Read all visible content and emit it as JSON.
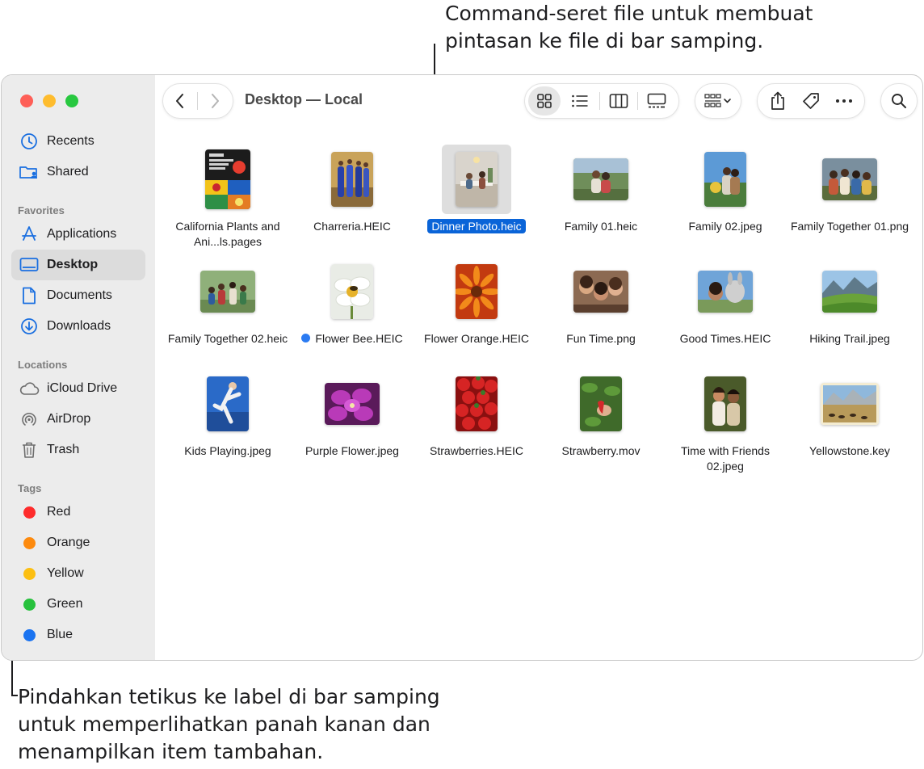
{
  "callouts": {
    "top_line1": "Command-seret file untuk membuat",
    "top_line2": "pintasan ke file di bar samping.",
    "bottom_line1": "Pindahkan tetikus ke label di bar samping",
    "bottom_line2": "untuk memperlihatkan panah kanan dan",
    "bottom_line3": "menampilkan item tambahan."
  },
  "window": {
    "traffic_lights": {
      "close": "#fe5f57",
      "minimize": "#febc2e",
      "zoom": "#28c840"
    },
    "path_title": "Desktop — Local"
  },
  "sidebar": {
    "top_items": [
      {
        "label": "Recents",
        "icon": "clock-icon"
      },
      {
        "label": "Shared",
        "icon": "shared-folder-icon"
      }
    ],
    "favorites_title": "Favorites",
    "favorites": [
      {
        "label": "Applications",
        "icon": "applications-icon"
      },
      {
        "label": "Desktop",
        "icon": "desktop-icon",
        "selected": true
      },
      {
        "label": "Documents",
        "icon": "document-icon"
      },
      {
        "label": "Downloads",
        "icon": "download-icon"
      }
    ],
    "locations_title": "Locations",
    "locations": [
      {
        "label": "iCloud Drive",
        "icon": "cloud-icon"
      },
      {
        "label": "AirDrop",
        "icon": "airdrop-icon"
      },
      {
        "label": "Trash",
        "icon": "trash-icon"
      }
    ],
    "tags_title": "Tags",
    "tags": [
      {
        "label": "Red",
        "color": "#fe2c2c"
      },
      {
        "label": "Orange",
        "color": "#fd8a0e"
      },
      {
        "label": "Yellow",
        "color": "#fcbf12"
      },
      {
        "label": "Green",
        "color": "#27c13d"
      },
      {
        "label": "Blue",
        "color": "#1a73f0"
      }
    ]
  },
  "toolbar": {
    "view_modes": [
      "icon-view-icon",
      "list-view-icon",
      "column-view-icon",
      "gallery-view-icon"
    ],
    "selected_view": "icon-view-icon",
    "group_icon": "group-by-icon",
    "actions": [
      "share-icon",
      "tag-icon",
      "more-icon"
    ],
    "search_icon": "search-icon"
  },
  "files": [
    {
      "name": "California Plants and Ani...ls.pages",
      "icon": "pages-document-thumbnail"
    },
    {
      "name": "Charreria.HEIC",
      "icon": "photo-thumbnail"
    },
    {
      "name": "Dinner Photo.heic",
      "icon": "photo-thumbnail",
      "selected": true
    },
    {
      "name": "Family 01.heic",
      "icon": "photo-thumbnail"
    },
    {
      "name": "Family 02.jpeg",
      "icon": "photo-thumbnail"
    },
    {
      "name": "Family Together 01.png",
      "icon": "photo-thumbnail"
    },
    {
      "name": "Family Together 02.heic",
      "icon": "photo-thumbnail"
    },
    {
      "name": "Flower Bee.HEIC",
      "icon": "photo-thumbnail",
      "tag_color": "#2b7bf2"
    },
    {
      "name": "Flower Orange.HEIC",
      "icon": "photo-thumbnail"
    },
    {
      "name": "Fun Time.png",
      "icon": "photo-thumbnail"
    },
    {
      "name": "Good Times.HEIC",
      "icon": "photo-thumbnail"
    },
    {
      "name": "Hiking Trail.jpeg",
      "icon": "photo-thumbnail"
    },
    {
      "name": "Kids Playing.jpeg",
      "icon": "photo-thumbnail"
    },
    {
      "name": "Purple Flower.jpeg",
      "icon": "photo-thumbnail"
    },
    {
      "name": "Strawberries.HEIC",
      "icon": "photo-thumbnail"
    },
    {
      "name": "Strawberry.mov",
      "icon": "video-thumbnail"
    },
    {
      "name": "Time with Friends 02.jpeg",
      "icon": "photo-thumbnail"
    },
    {
      "name": "Yellowstone.key",
      "icon": "keynote-document-thumbnail"
    }
  ]
}
